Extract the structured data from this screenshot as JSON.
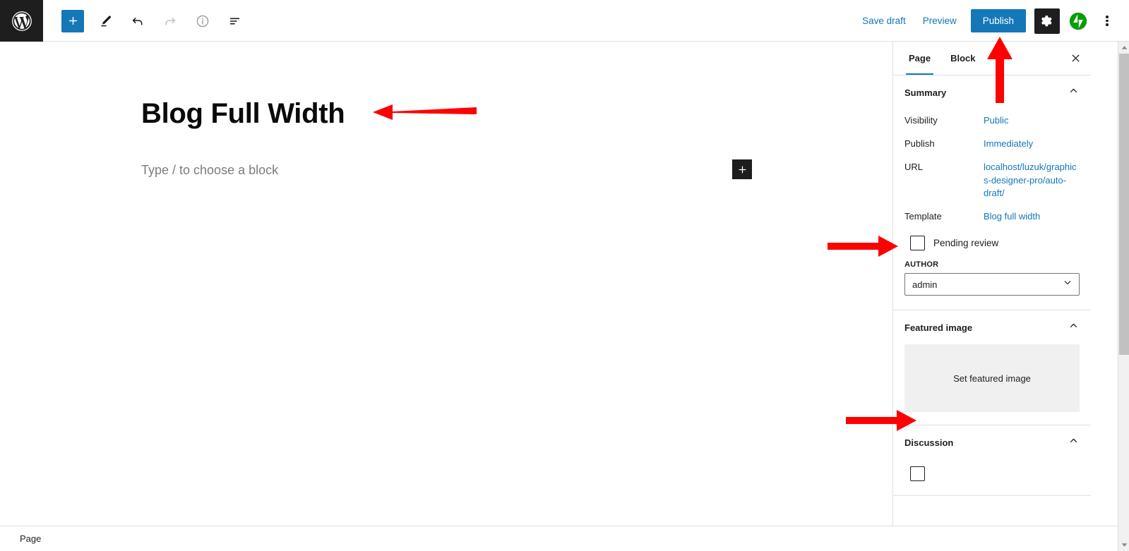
{
  "toolbar": {
    "logo_icon": "wordpress-logo-icon",
    "inserter_label": "+",
    "tools_icon": "pencil-icon",
    "undo_icon": "undo-arrow-icon",
    "redo_icon": "redo-arrow-icon",
    "info_icon": "info-circle-icon",
    "listview_icon": "list-view-icon",
    "save_draft_label": "Save draft",
    "preview_label": "Preview",
    "publish_label": "Publish",
    "settings_icon": "gear-icon",
    "jetpack_icon": "jetpack-icon",
    "options_icon": "kebab-menu-icon"
  },
  "editor": {
    "title": "Blog Full Width",
    "block_placeholder": "Type / to choose a block",
    "inserter_icon": "plus-icon"
  },
  "status_bar": {
    "document_type": "Page"
  },
  "sidebar": {
    "tabs": [
      {
        "label": "Page",
        "active": true
      },
      {
        "label": "Block",
        "active": false
      }
    ],
    "close_icon": "close-x-icon",
    "summary": {
      "title": "Summary",
      "collapse_icon": "chevron-up-icon",
      "rows": [
        {
          "label": "Visibility",
          "value": "Public"
        },
        {
          "label": "Publish",
          "value": "Immediately"
        },
        {
          "label": "URL",
          "value": "localhost/luzuk/graphics-designer-pro/auto-draft/"
        },
        {
          "label": "Template",
          "value": "Blog full width"
        }
      ],
      "pending_review_label": "Pending review",
      "pending_review_checked": false,
      "author_field_label": "AUTHOR",
      "author_value": "admin",
      "author_chevron_icon": "chevron-down-icon"
    },
    "featured_image": {
      "title": "Featured image",
      "collapse_icon": "chevron-up-icon",
      "set_label": "Set featured image"
    },
    "discussion": {
      "title": "Discussion",
      "collapse_icon": "chevron-up-icon"
    }
  },
  "scrollbar": {
    "up_icon": "scroll-up-arrow-icon",
    "down_icon": "scroll-down-arrow-icon"
  },
  "colors": {
    "accent": "#1477b8",
    "dark": "#1e1e1e",
    "annotation": "#ff0000"
  }
}
